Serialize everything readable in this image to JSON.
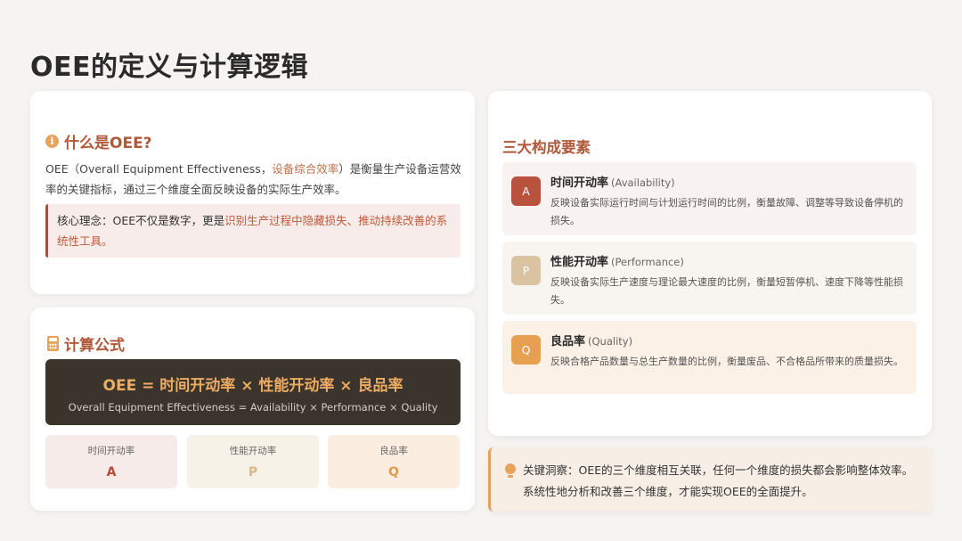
{
  "page": {
    "title": "OEE的定义与计算逻辑"
  },
  "what": {
    "heading": "什么是OEE?",
    "intro_a": "OEE（Overall Equipment Effectiveness，",
    "intro_hl": "设备综合效率",
    "intro_b": "）是衡量生产设备运营效率的关键指标，通过三个维度全面反映设备的实际生产效率。",
    "core_a": "核心理念：OEE不仅是数字，更是",
    "core_hl": "识别生产过程中隐藏损失、推动持续改善的系统性工具。"
  },
  "formula": {
    "heading": "计算公式",
    "main": "OEE = 时间开动率 × 性能开动率 × 良品率",
    "sub": "Overall Equipment Effectiveness = Availability × Performance × Quality",
    "boxes": [
      {
        "label": "时间开动率",
        "letter": "A"
      },
      {
        "label": "性能开动率",
        "letter": "P"
      },
      {
        "label": "良品率",
        "letter": "Q"
      }
    ]
  },
  "elements": {
    "heading": "三大构成要素",
    "items": [
      {
        "badge": "A",
        "name": "时间开动率",
        "en": "(Availability)",
        "desc": "反映设备实际运行时间与计划运行时间的比例，衡量故障、调整等导致设备停机的损失。"
      },
      {
        "badge": "P",
        "name": "性能开动率",
        "en": "(Performance)",
        "desc": "反映设备实际生产速度与理论最大速度的比例，衡量短暂停机、速度下降等性能损失。"
      },
      {
        "badge": "Q",
        "name": "良品率",
        "en": "(Quality)",
        "desc": "反映合格产品数量与总生产数量的比例，衡量废品、不合格品所带来的质量损失。"
      }
    ]
  },
  "insight": {
    "text": "关键洞察：OEE的三个维度相互关联，任何一个维度的损失都会影响整体效率。系统性地分析和改善三个维度，才能实现OEE的全面提升。"
  },
  "colors": {
    "accent": "#b0583a",
    "orange": "#e7a25c",
    "dark": "#3b342c"
  }
}
